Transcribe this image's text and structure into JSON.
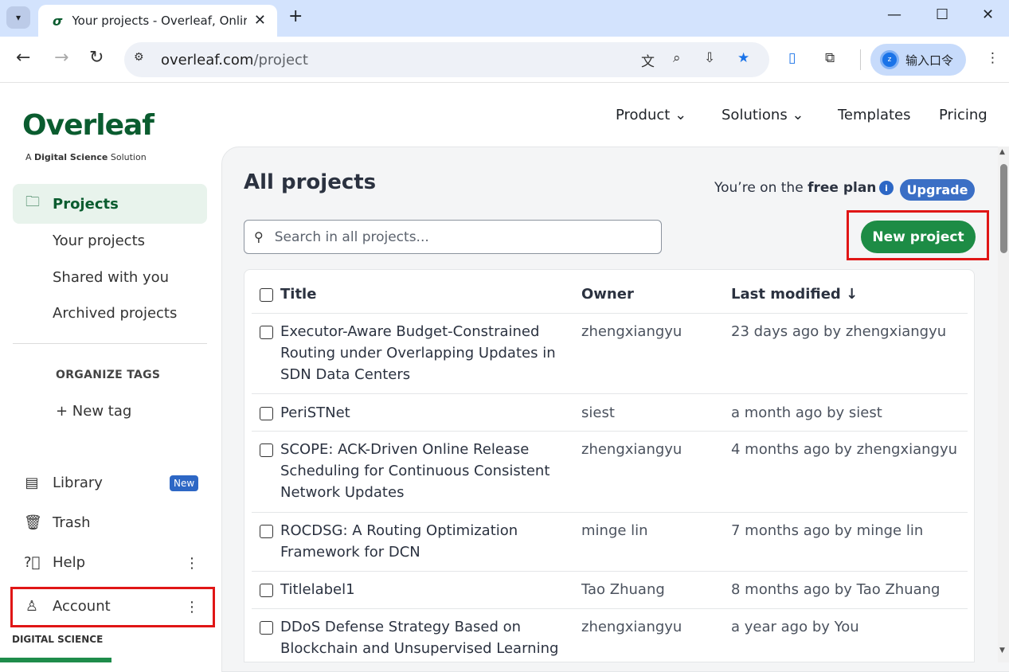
{
  "browser": {
    "tab_title": "Your projects - Overleaf, Onlir",
    "favicon": "σ",
    "url_host": "overleaf.com",
    "url_path": "/project",
    "profile_label": "输入口令",
    "profile_initial": "z"
  },
  "header": {
    "logo": "Overleaf",
    "logo_prefix": "A ",
    "logo_brand": "Digital Science",
    "logo_suffix": " Solution",
    "nav": {
      "product": "Product ⌄",
      "solutions": "Solutions ⌄",
      "templates": "Templates",
      "pricing": "Pricing"
    }
  },
  "sidebar": {
    "projects": "Projects",
    "your_projects": "Your projects",
    "shared_with_you": "Shared with you",
    "archived_projects": "Archived projects",
    "organize_tags": "ORGANIZE TAGS",
    "new_tag": "+ New tag",
    "library": "Library",
    "library_badge": "New",
    "trash": "Trash",
    "help": "Help",
    "account": "Account",
    "footer": "DIGITAL SCIENCE"
  },
  "main": {
    "heading": "All projects",
    "plan_prefix": "You’re on the ",
    "plan_name": "free plan",
    "upgrade": "Upgrade",
    "search_placeholder": "Search in all projects...",
    "new_project": "New project",
    "columns": {
      "title": "Title",
      "owner": "Owner",
      "last_modified": "Last modified ↓"
    },
    "rows": [
      {
        "title": "Executor-Aware Budget-Constrained Routing under Overlapping Updates in SDN Data Centers",
        "owner": "zhengxiangyu",
        "modified": "23 days ago by zhengxiangyu"
      },
      {
        "title": "PeriSTNet",
        "owner": "siest",
        "modified": "a month ago by siest"
      },
      {
        "title": "SCOPE: ACK-Driven Online Release Scheduling for Continuous Consistent Network Updates",
        "owner": "zhengxiangyu",
        "modified": "4 months ago by zhengxiangyu"
      },
      {
        "title": "ROCDSG: A Routing Optimization Framework for DCN",
        "owner": "minge lin",
        "modified": "7 months ago by minge lin"
      },
      {
        "title": "Titlelabel1",
        "owner": "Tao Zhuang",
        "modified": "8 months ago by Tao Zhuang"
      },
      {
        "title": "DDoS Defense Strategy Based on Blockchain and Unsupervised Learning",
        "owner": "zhengxiangyu",
        "modified": "a year ago by You"
      }
    ]
  },
  "colors": {
    "brand_green": "#1d8c45",
    "highlight_red": "#e01616",
    "upgrade_blue": "#3b6fc5"
  }
}
